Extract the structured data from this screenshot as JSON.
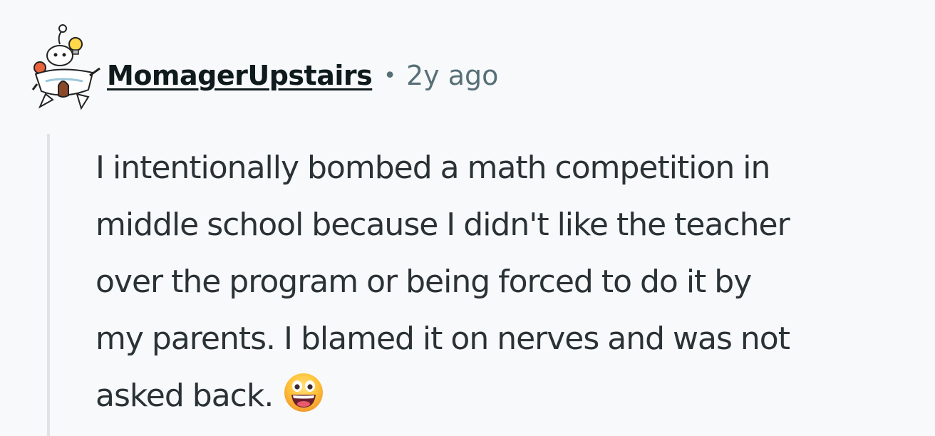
{
  "comment": {
    "author": "MomagerUpstairs",
    "separator": "•",
    "time_ago": "2y ago",
    "avatar_icon": "reddit-snoo-avatar-icon",
    "body_lines": [
      "I intentionally bombed a math competition in",
      "middle school because I didn't like the teacher",
      "over the program or being forced to do it by",
      "my parents. I blamed it on nerves and was not",
      "asked back."
    ],
    "emoji_icon": "grinning-face-emoji-icon"
  },
  "colors": {
    "background": "#f8f9fb",
    "text": "#2a3236",
    "meta": "#576f76",
    "thread_line": "#dfe3e7"
  }
}
